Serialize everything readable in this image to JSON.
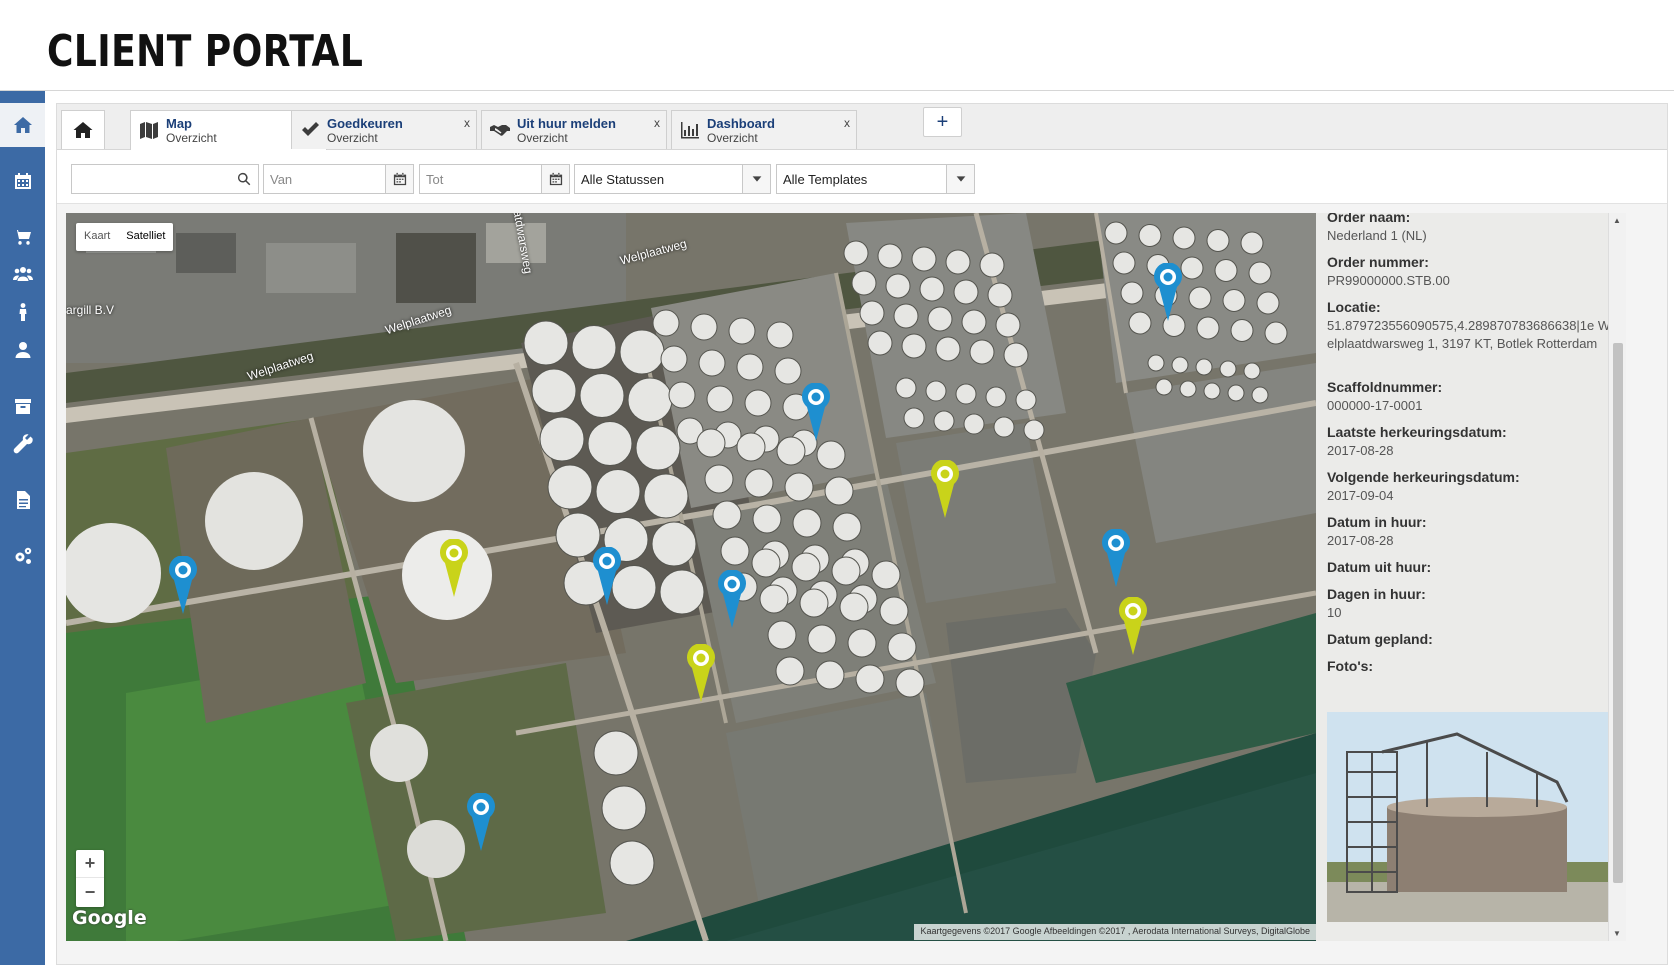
{
  "app": {
    "title": "CLIENT PORTAL"
  },
  "sidebar": {
    "items": [
      {
        "icon": "home-icon"
      },
      {
        "icon": "calendar-icon"
      },
      {
        "icon": "cart-icon"
      },
      {
        "icon": "users-icon"
      },
      {
        "icon": "person-icon"
      },
      {
        "icon": "user-icon"
      },
      {
        "icon": "archive-icon"
      },
      {
        "icon": "wrench-icon"
      },
      {
        "icon": "document-icon"
      },
      {
        "icon": "settings-icon"
      }
    ]
  },
  "tabs": [
    {
      "icon": "map-icon",
      "title": "Map",
      "subtitle": "Overzicht",
      "close": "x",
      "active": true
    },
    {
      "icon": "check-icon",
      "title": "Goedkeuren",
      "subtitle": "Overzicht",
      "close": "x",
      "active": false
    },
    {
      "icon": "handshake-icon",
      "title": "Uit huur melden",
      "subtitle": "Overzicht",
      "close": "x",
      "active": false
    },
    {
      "icon": "bar-chart-icon",
      "title": "Dashboard",
      "subtitle": "Overzicht",
      "close": "x",
      "active": false
    }
  ],
  "tab_add_label": "+",
  "filters": {
    "search_value": "",
    "from_placeholder": "Van",
    "to_placeholder": "Tot",
    "status_selected": "Alle Statussen",
    "template_selected": "Alle Templates"
  },
  "map": {
    "type_options": [
      "Kaart",
      "Satelliet"
    ],
    "type_selected": "Satelliet",
    "zoom_in": "+",
    "zoom_out": "−",
    "logo": "Google",
    "attribution": "Kaartgegevens ©2017 Google Afbeeldingen ©2017 , Aerodata International Surveys, DigitalGlobe",
    "place_label": "argill B.V",
    "roads": [
      "Welplaatweg",
      "Welplaatweg",
      "Welplaatweg",
      "atdwarsweg"
    ],
    "pin_colors": {
      "blue": "#1e8fd0",
      "yellow": "#c9d31a"
    }
  },
  "info": {
    "order_name_label": "Order naam:",
    "order_name": "Nederland 1 (NL)",
    "order_number_label": "Order nummer:",
    "order_number": "PR99000000.STB.00",
    "location_label": "Locatie:",
    "location": "51.879723556090575,4.289870783686638|1e Welplaatdwarsweg 1, 3197 KT, Botlek Rotterdam",
    "scaffold_label": "Scaffoldnummer:",
    "scaffold": "000000-17-0001",
    "last_inspection_label": "Laatste herkeuringsdatum:",
    "last_inspection": "2017-08-28",
    "next_inspection_label": "Volgende herkeuringsdatum:",
    "next_inspection": "2017-09-04",
    "date_in_label": "Datum in huur:",
    "date_in": "2017-08-28",
    "date_out_label": "Datum uit huur:",
    "date_out": "",
    "days_label": "Dagen in huur:",
    "days": "10",
    "planned_label": "Datum gepland:",
    "planned": "",
    "photos_label": "Foto's:"
  }
}
